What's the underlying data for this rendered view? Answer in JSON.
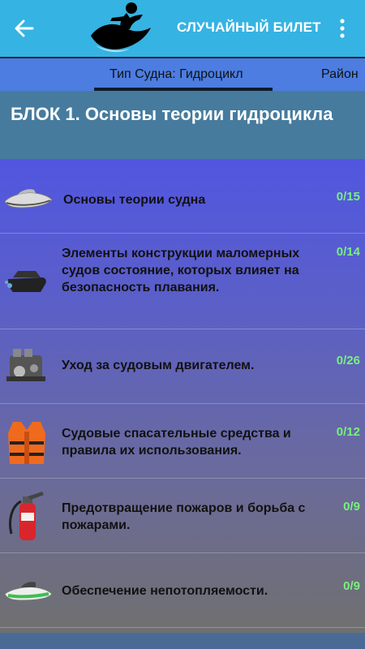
{
  "app_bar": {
    "title": "СЛУЧАЙНЫЙ БИЛЕТ",
    "back_icon": "arrow-left-icon",
    "menu_icon": "more-vert-icon",
    "logo": "jet-ski-rider-logo"
  },
  "tabs": [
    {
      "label": "Тип Судна: Гидроцикл",
      "selected": true
    },
    {
      "label": "Район",
      "selected": false
    }
  ],
  "block": {
    "title": "БЛОК 1. Основы теории гидроцикла"
  },
  "items": [
    {
      "label": "Основы теории судна",
      "count": "0/15",
      "icon": "jet-ski-icon"
    },
    {
      "label": "Элементы конструкции маломерных судов состояние, которых влияет на безопасность плавания.",
      "count": "0/14",
      "icon": "boat-hull-icon"
    },
    {
      "label": "Уход за судовым двигателем.",
      "count": "0/26",
      "icon": "engine-icon"
    },
    {
      "label": "Судовые спасательные средства и правила их использования.",
      "count": "0/12",
      "icon": "life-jacket-icon"
    },
    {
      "label": "Предотвращение пожаров и борьба с пожарами.",
      "count": "0/9",
      "icon": "fire-extinguisher-icon"
    },
    {
      "label": "Обеспечение непотопляемости.",
      "count": "0/9",
      "icon": "jet-ski-green-icon"
    }
  ],
  "colors": {
    "app_bar": "#35b3e3",
    "tab_bar": "#4d7de0",
    "block_header": "#467b9e",
    "count": "#78f07e"
  }
}
